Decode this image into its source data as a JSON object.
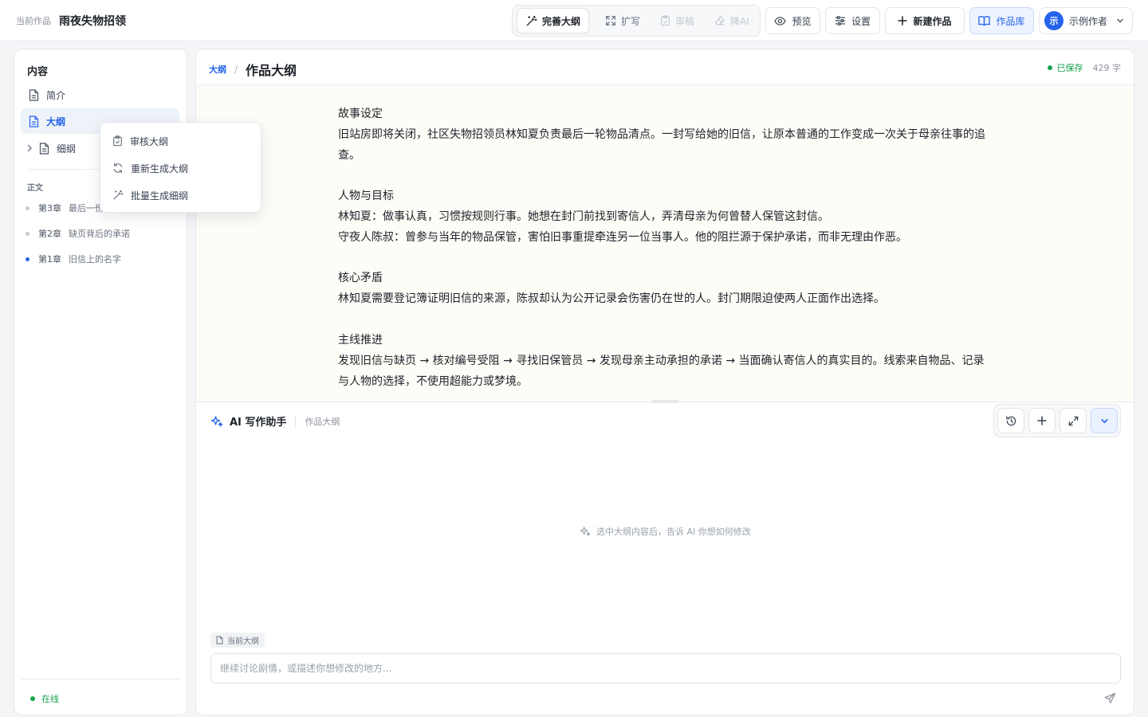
{
  "topbar": {
    "current_label": "当前作品",
    "work_title": "雨夜失物招领",
    "tools": {
      "refine": "完善大纲",
      "expand": "扩写",
      "review": "审稿",
      "de_ai": "降AI"
    },
    "preview": "预览",
    "settings": "设置",
    "new_work": "新建作品",
    "library": "作品库",
    "user": {
      "avatar_initial": "示",
      "name": "示例作者"
    }
  },
  "sidebar": {
    "heading": "内容",
    "items": [
      {
        "label": "简介",
        "icon": "document-icon"
      },
      {
        "label": "大纲",
        "icon": "document-icon",
        "active": true
      },
      {
        "label": "细纲",
        "icon": "document-icon",
        "collapsed": true
      }
    ],
    "body_heading": "正文",
    "chapters": [
      {
        "num": "第3章",
        "name": "最后一份",
        "current": false
      },
      {
        "num": "第2章",
        "name": "缺页背后的承诺",
        "current": false
      },
      {
        "num": "第1章",
        "name": "旧信上的名字",
        "current": true
      }
    ],
    "status": "在线"
  },
  "context_menu": {
    "items": [
      {
        "label": "审核大纲",
        "icon": "clipboard-check-icon"
      },
      {
        "label": "重新生成大纲",
        "icon": "refresh-icon"
      },
      {
        "label": "批量生成细纲",
        "icon": "magic-wand-icon"
      }
    ]
  },
  "editor": {
    "breadcrumb_parent": "大纲",
    "breadcrumb_sep": "/",
    "title": "作品大纲",
    "save_status": "已保存",
    "word_count": "429 字",
    "sections": [
      {
        "heading": "故事设定",
        "lines": [
          "旧站房即将关闭，社区失物招领员林知夏负责最后一轮物品清点。一封写给她的旧信，让原本普通的工作变成一次关于母亲往事的追查。"
        ]
      },
      {
        "heading": "人物与目标",
        "lines": [
          "林知夏：做事认真，习惯按规则行事。她想在封门前找到寄信人，弄清母亲为何曾替人保管这封信。",
          "守夜人陈叔：曾参与当年的物品保管，害怕旧事重提牵连另一位当事人。他的阻拦源于保护承诺，而非无理由作恶。"
        ]
      },
      {
        "heading": "核心矛盾",
        "lines": [
          "林知夏需要登记簿证明旧信的来源，陈叔却认为公开记录会伤害仍在世的人。封门期限迫使两人正面作出选择。"
        ]
      },
      {
        "heading": "主线推进",
        "lines": [
          "发现旧信与缺页 → 核对编号受阻 → 寻找旧保管员 → 发现母亲主动承担的承诺 → 当面确认寄信人的真实目的。线索来自物品、记录与人物的选择，不使用超能力或梦境。"
        ]
      }
    ]
  },
  "ai_panel": {
    "title": "AI 写作助手",
    "context": "作品大纲",
    "hint": "选中大纲内容后，告诉 AI 你想如何修改",
    "chip": "当前大纲",
    "input_placeholder": "继续讨论剧情，或描述你想修改的地方..."
  },
  "colors": {
    "accent": "#2563eb",
    "success": "#16a34a",
    "doc_background": "#fdfcf7"
  }
}
